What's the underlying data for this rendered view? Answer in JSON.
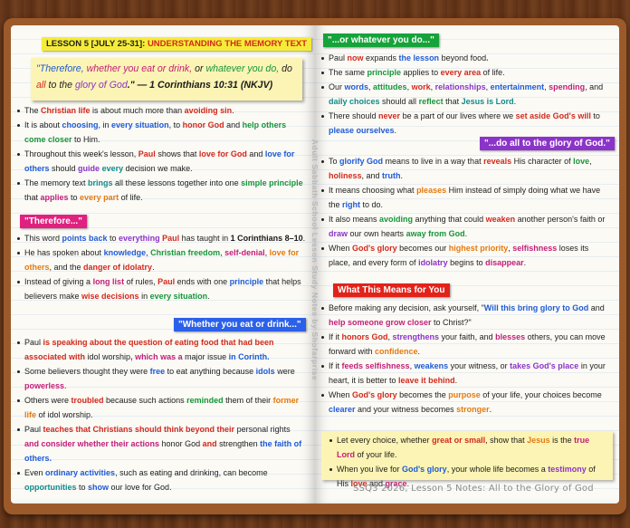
{
  "spine_text": "Adult Sabbath School Lesson Study Notes by Shofarprise",
  "footer": "SSQ3 2026, Lesson 5 Notes: All to the Glory of God",
  "colors": {
    "red": "#d22a1d",
    "blue": "#1f5bd6",
    "green": "#17963a",
    "purple": "#8b34c9",
    "orange": "#e47a10",
    "magenta": "#c21f78",
    "teal": "#138b8a",
    "note_yellow": "#fcf4b4",
    "cover": "#9c5a2b"
  },
  "left": {
    "title": {
      "lesson": "LESSON 5 [JULY 25-31]: ",
      "topic": "UNDERSTANDING THE MEMORY TEXT"
    },
    "quote": {
      "open": "\"Therefore, ",
      "w1": "whether you eat or drink,",
      "w2": " or ",
      "w3": "whatever you do,",
      "w4": " do ",
      "w5": "all",
      "w6": " to the ",
      "w7": "glory of God",
      "w8": ".\" — 1 Corinthians 10:31 (NKJV)"
    },
    "intro": [
      [
        "The ",
        "Christian life",
        " is about much more than ",
        "avoiding sin",
        "."
      ],
      [
        "It is about ",
        "choosing",
        ", in ",
        "every situation",
        ", to ",
        "honor God",
        " and ",
        "help others come closer",
        " to Him."
      ],
      [
        "Throughout this week's lesson, ",
        "Paul",
        " shows that ",
        "love for God",
        " and ",
        "love for others",
        " should ",
        "guide",
        " ",
        "every",
        " decision we make."
      ],
      [
        "The memory text ",
        "brings",
        " all these lessons together into one ",
        "simple principle",
        " that ",
        "applies",
        " to ",
        "every part",
        " of life."
      ]
    ],
    "therefore_heading": "\"Therefore...\"",
    "therefore": [
      [
        "This word ",
        "points back",
        " to ",
        "everything",
        " ",
        "Paul",
        " has taught in ",
        "1 Corinthians 8–10",
        "."
      ],
      [
        "He has spoken about ",
        "knowledge",
        ", ",
        "Christian freedom",
        ", ",
        "self-denial",
        ", ",
        "love for others",
        ", and the ",
        "danger of idolatry",
        "."
      ],
      [
        "Instead of giving a ",
        "long list",
        " of rules, ",
        "Paul",
        " ends with one ",
        "principle",
        " that helps believers make ",
        "wise decisions",
        " in ",
        "every situation",
        "."
      ]
    ],
    "eat_heading": "\"Whether you eat or drink...\"",
    "eat": [
      [
        "Paul",
        " is speaking about the question of eating food that had been associated with ",
        "idol worship",
        ", which was a ",
        "major issue",
        " in Corinth."
      ],
      [
        "Some believers thought they were ",
        "free",
        " to eat anything because ",
        "idols",
        " were ",
        "powerless",
        "."
      ],
      [
        "Others were ",
        "troubled",
        " because such actions ",
        "reminded",
        " them of their ",
        "former life",
        " of idol worship."
      ],
      [
        "Paul",
        " teaches that Christians should think beyond their ",
        "personal rights",
        " and consider whether their actions ",
        "honor God",
        " and ",
        "strengthen",
        " the faith of others."
      ],
      [
        "Even ",
        "ordinary activities",
        ", such as eating and drinking, can become ",
        "opportunities",
        " to ",
        "show",
        " our love for God."
      ]
    ]
  },
  "right": {
    "whatever_heading": "\"...or whatever you do...\"",
    "whatever": [
      [
        "Paul",
        " now ",
        "expands",
        " the lesson ",
        "beyond food",
        "."
      ],
      [
        "The same ",
        "principle",
        " applies to ",
        "every area",
        " of life."
      ],
      [
        "Our ",
        "words",
        ", ",
        "attitudes",
        ", ",
        "work",
        ", ",
        "relationships",
        ", ",
        "entertainment",
        ", ",
        "spending",
        ", and ",
        "daily choices",
        " should all ",
        "reflect",
        " that ",
        "Jesus is Lord",
        "."
      ],
      [
        "There should ",
        "never",
        " be a part of our lives where we ",
        "set aside God's will",
        " to ",
        "please ourselves",
        "."
      ]
    ],
    "glory_heading": "\"...do all to the glory of God.\"",
    "glory": [
      [
        "To ",
        "glorify God",
        " means to live in a way that ",
        "reveals",
        " His character of ",
        "love",
        ", ",
        "holiness",
        ", and ",
        "truth",
        "."
      ],
      [
        "It means choosing what ",
        "pleases",
        " Him instead of simply doing what we have the ",
        "right",
        " to do."
      ],
      [
        "It also means ",
        "avoiding",
        " anything that could ",
        "weaken",
        " another person's faith or ",
        "draw",
        " our own hearts ",
        "away from God",
        "."
      ],
      [
        "When ",
        "God's glory",
        " becomes our ",
        "highest priority",
        ", ",
        "selfishness",
        " loses its place, and every form of ",
        "idolatry",
        " begins to ",
        "disappear",
        "."
      ]
    ],
    "means_heading": "What This Means for You",
    "means": [
      [
        "Before making any decision, ask yourself, \"",
        "Will this bring glory to God",
        " and ",
        "help someone grow closer",
        " to Christ?\""
      ],
      [
        "If it ",
        "honors God",
        ", ",
        "strengthens",
        " your faith, and ",
        "blesses",
        " others, you can move forward with ",
        "confidence",
        "."
      ],
      [
        "If it ",
        "feeds selfishness",
        ", ",
        "weakens",
        " your witness, or ",
        "takes God's place",
        " in your heart, it is better to ",
        "leave it behind",
        "."
      ],
      [
        "When ",
        "God's glory",
        " becomes the ",
        "purpose",
        " of your life, your choices become ",
        "clearer",
        " and your witness becomes ",
        "stronger",
        "."
      ]
    ],
    "note": [
      [
        "Let every choice, whether ",
        "great or small",
        ", show that ",
        "Jesus",
        " is the ",
        "true Lord",
        " of your life."
      ],
      [
        "When you live for ",
        "God's glory",
        ", your whole life becomes a ",
        "testimony",
        " of His ",
        "love",
        " and ",
        "grace",
        "."
      ]
    ]
  }
}
